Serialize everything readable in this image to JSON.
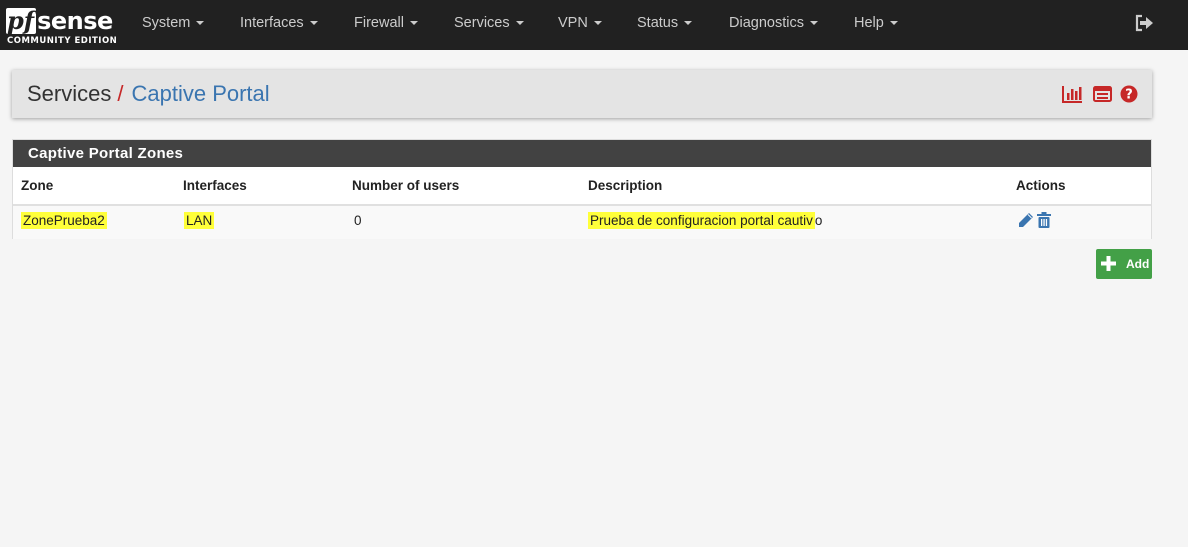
{
  "brand": {
    "logo_pf": "pf",
    "logo_sense": "sense",
    "edition": "COMMUNITY EDITION"
  },
  "nav": {
    "items": [
      {
        "label": "System"
      },
      {
        "label": "Interfaces"
      },
      {
        "label": "Firewall"
      },
      {
        "label": "Services"
      },
      {
        "label": "VPN"
      },
      {
        "label": "Status"
      },
      {
        "label": "Diagnostics"
      },
      {
        "label": "Help"
      }
    ],
    "logout_icon": "sign-out-icon"
  },
  "breadcrumb": {
    "section": "Services",
    "separator": "/",
    "page": "Captive Portal"
  },
  "header_icons": [
    "bar-chart-icon",
    "list-log-icon",
    "help-icon"
  ],
  "zones_panel": {
    "title": "Captive Portal Zones",
    "columns": [
      "Zone",
      "Interfaces",
      "Number of users",
      "Description",
      "Actions"
    ],
    "rows": [
      {
        "zone": "ZonePrueba2",
        "interfaces": "LAN",
        "users": "0",
        "description_highlighted": "Prueba de configuracion portal cautiv",
        "description_rest": "o"
      }
    ]
  },
  "add_button": {
    "label": "Add"
  },
  "colors": {
    "navbar": "#212121",
    "link": "#3a75b0",
    "accent_red": "#c62828",
    "add_green": "#43a047",
    "highlight": "#ffff3a"
  }
}
